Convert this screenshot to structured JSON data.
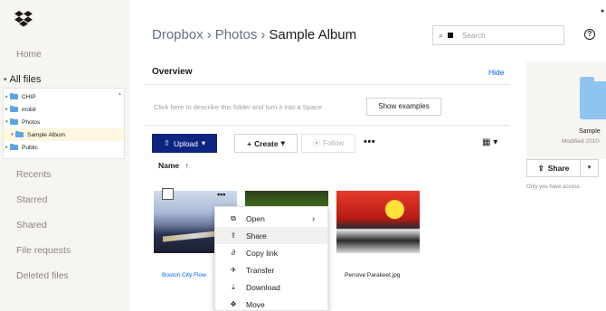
{
  "sidebar": {
    "home": "Home",
    "all_files": "All files",
    "tree": [
      {
        "label": "CHIP"
      },
      {
        "label": "mobil"
      },
      {
        "label": "Photos"
      },
      {
        "label": "Sample Album"
      },
      {
        "label": "Public"
      }
    ],
    "links": [
      "Recents",
      "Starred",
      "Shared",
      "File requests",
      "Deleted files"
    ]
  },
  "breadcrumb": {
    "root": "Dropbox",
    "parent": "Photos",
    "current": "Sample Album",
    "separator": "›"
  },
  "search": {
    "placeholder": "Search"
  },
  "overview": {
    "title": "Overview",
    "hide": "Hide",
    "describe": "Click here to describe this folder and turn it into a Space",
    "show_examples": "Show examples"
  },
  "toolbar": {
    "upload": "Upload",
    "create": "Create",
    "follow": "Follow"
  },
  "sort": {
    "label": "Name",
    "arrow": "↑"
  },
  "files": [
    {
      "caption": "Boston City Flow"
    },
    {
      "caption": ""
    },
    {
      "caption": "Pensive Parakeet.jpg"
    }
  ],
  "context_menu": {
    "items": [
      {
        "label": "Open",
        "icon": "open-icon",
        "glyph": "⧉"
      },
      {
        "label": "Share",
        "icon": "share-icon",
        "glyph": "⇪"
      },
      {
        "label": "Copy link",
        "icon": "link-icon",
        "glyph": "∂"
      },
      {
        "label": "Transfer",
        "icon": "transfer-icon",
        "glyph": "✈"
      },
      {
        "label": "Download",
        "icon": "download-icon",
        "glyph": "⤓"
      },
      {
        "label": "Move",
        "icon": "move-icon",
        "glyph": "✥"
      }
    ],
    "highlighted": "Share"
  },
  "right_panel": {
    "title": "Sample",
    "modified": "Modified 2010-",
    "share": "Share",
    "access": "Only you have access"
  },
  "colors": {
    "brand": "#0061fe",
    "upload_bg": "#0d2481",
    "sidebar_bg": "#f7f5f2"
  }
}
